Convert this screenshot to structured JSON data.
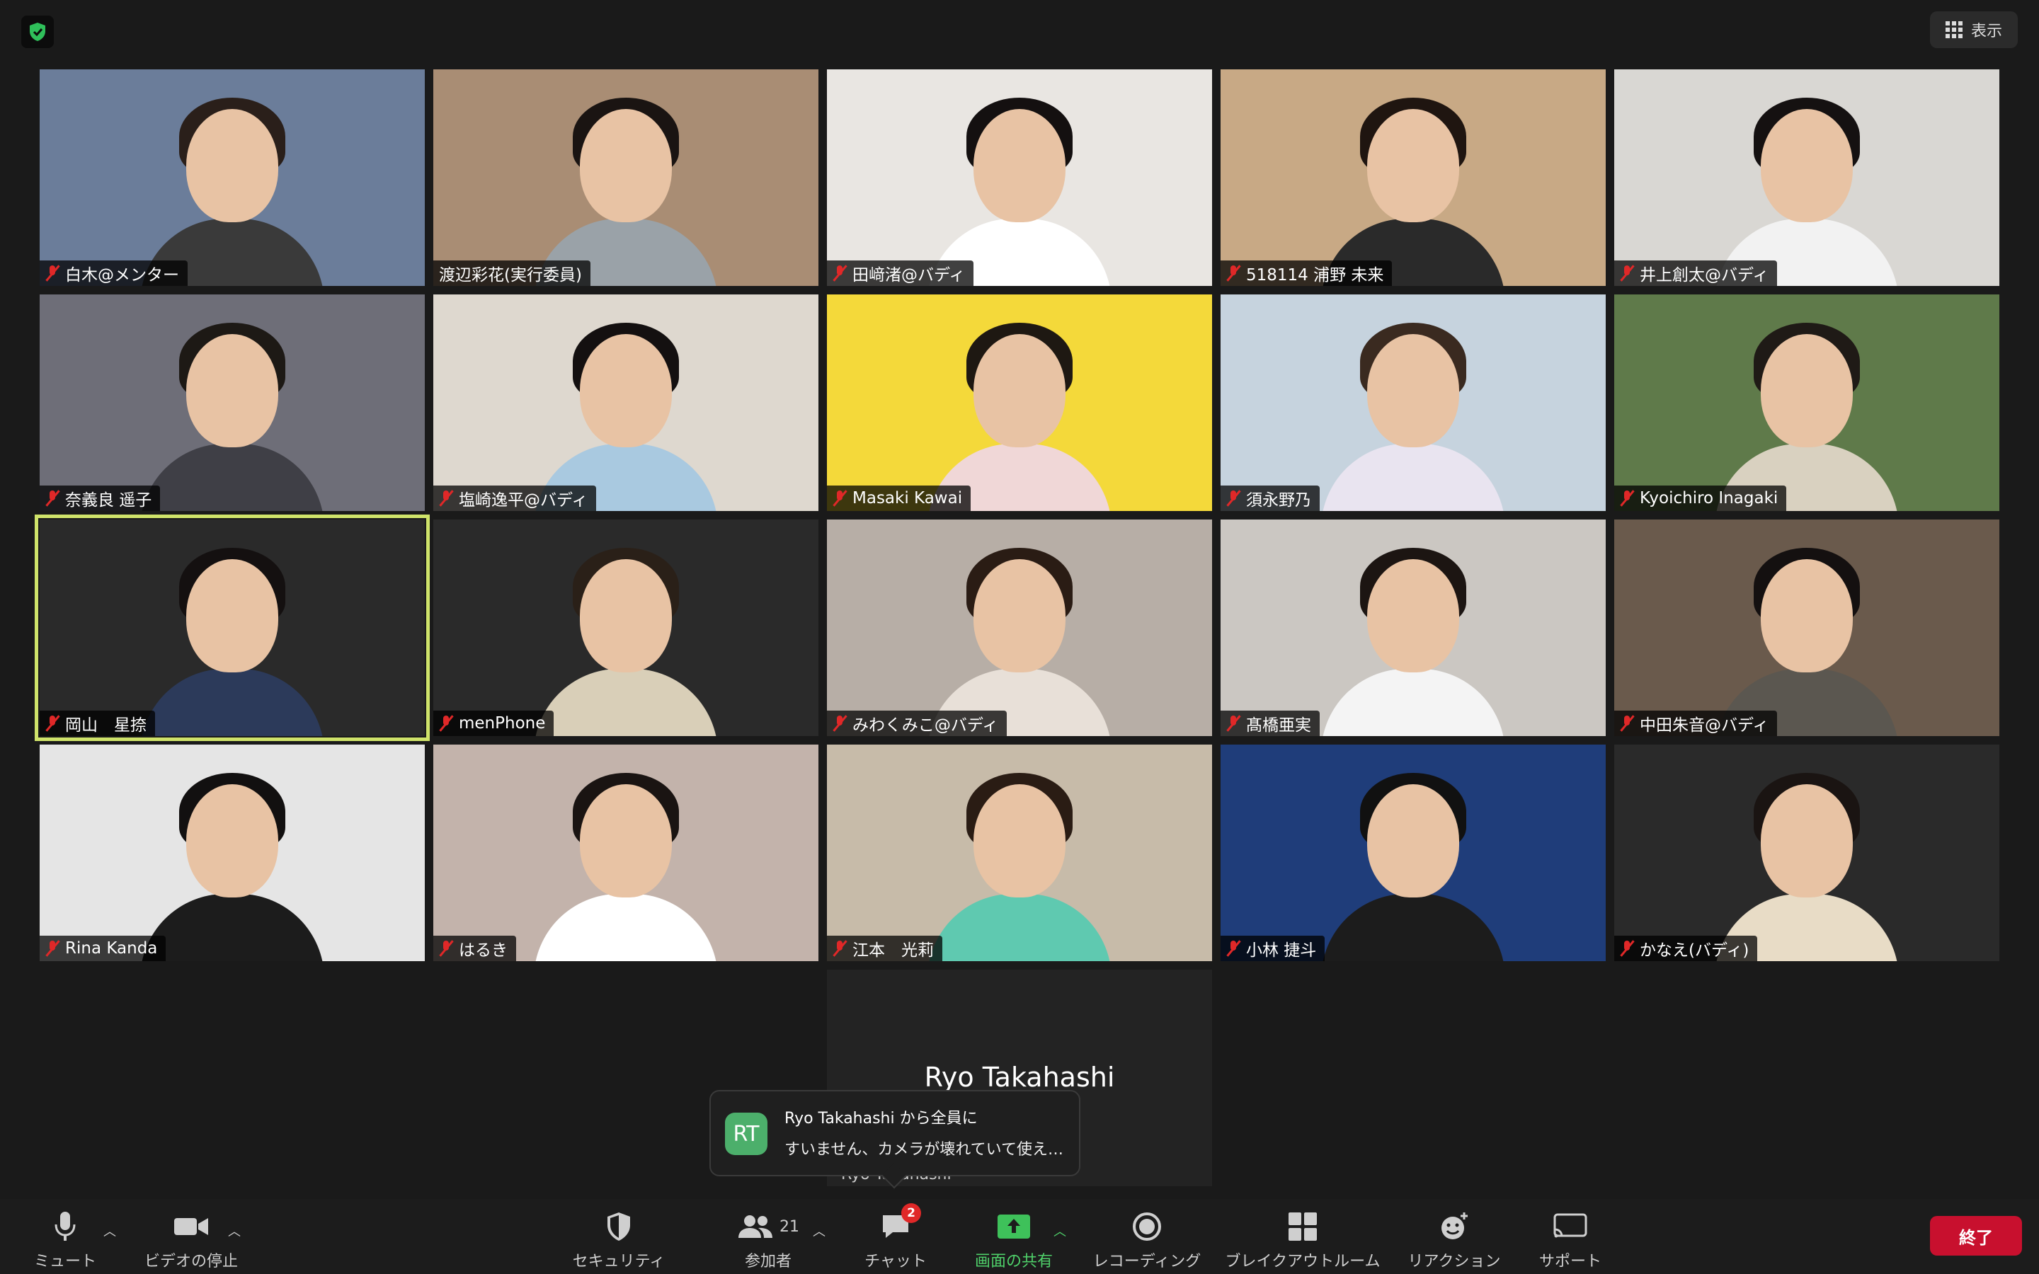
{
  "top": {
    "view_label": "表示"
  },
  "participants": [
    {
      "name": "白木@メンター",
      "muted": true,
      "bg": "#6b7d9a",
      "hair": "#2a1f1a",
      "shirt": "#3a3a3a"
    },
    {
      "name": "渡辺彩花(実行委員)",
      "muted": false,
      "bg": "#a98d74",
      "hair": "#1a1412",
      "shirt": "#9aa2a8"
    },
    {
      "name": "田﨑渚@バディ",
      "muted": true,
      "bg": "#e9e6e2",
      "hair": "#141010",
      "shirt": "#ffffff"
    },
    {
      "name": "518114 浦野 未来",
      "muted": true,
      "bg": "#c8a985",
      "hair": "#1f1510",
      "shirt": "#2a2a2a"
    },
    {
      "name": "井上創太@バディ",
      "muted": true,
      "bg": "#d9d7d3",
      "hair": "#151111",
      "shirt": "#f2f2f2"
    },
    {
      "name": "奈義良 遥子",
      "muted": true,
      "bg": "#6e6e78",
      "hair": "#1d1915",
      "shirt": "#3f3f46"
    },
    {
      "name": "塩崎逸平@バディ",
      "muted": true,
      "bg": "#ded8cf",
      "hair": "#141010",
      "shirt": "#a9c9e0"
    },
    {
      "name": "Masaki Kawai",
      "muted": true,
      "bg": "#f4d93a",
      "hair": "#1e1812",
      "shirt": "#f0d7d7"
    },
    {
      "name": "須永野乃",
      "muted": true,
      "bg": "#c6d3de",
      "hair": "#3a2a20",
      "shirt": "#e9e4f0"
    },
    {
      "name": "Kyoichiro Inagaki",
      "muted": true,
      "bg": "#5f7a4a",
      "hair": "#1f1a16",
      "shirt": "#d9d1c0"
    },
    {
      "name": "岡山　星捺",
      "muted": true,
      "bg": "#2a2a2a",
      "hair": "#141010",
      "shirt": "#2c3a5a"
    },
    {
      "name": "menPhone",
      "muted": true,
      "bg": "#2a2a2a",
      "hair": "#2a2018",
      "shirt": "#d9cfb8"
    },
    {
      "name": "みわくみこ@バディ",
      "muted": true,
      "bg": "#b7aea6",
      "hair": "#2a1c14",
      "shirt": "#e8e0d8"
    },
    {
      "name": "髙橋亜実",
      "muted": true,
      "bg": "#cbc7c2",
      "hair": "#1c1512",
      "shirt": "#f4f4f4"
    },
    {
      "name": "中田朱音@バディ",
      "muted": true,
      "bg": "#6a5a4c",
      "hair": "#141010",
      "shirt": "#5b5750"
    },
    {
      "name": "Rina Kanda",
      "muted": true,
      "bg": "#e5e5e5",
      "hair": "#121010",
      "shirt": "#1c1c1c"
    },
    {
      "name": "はるき",
      "muted": true,
      "bg": "#c3b3ab",
      "hair": "#1a1412",
      "shirt": "#ffffff"
    },
    {
      "name": "江本　光莉",
      "muted": true,
      "bg": "#c7bba9",
      "hair": "#2a1c14",
      "shirt": "#5fc9b0"
    },
    {
      "name": "小林 捷斗",
      "muted": true,
      "bg": "#1f3d7a",
      "hair": "#111111",
      "shirt": "#1c1c1c"
    },
    {
      "name": "かなえ(バディ)",
      "muted": true,
      "bg": "#2a2a2a",
      "hair": "#1a1412",
      "shirt": "#e8dcc6"
    }
  ],
  "camera_off_tile": {
    "name": "Ryo Takahashi",
    "small_name": "Ryo  Takahashi"
  },
  "chat_popup": {
    "avatar": "RT",
    "from": "Ryo Takahashi から全員に",
    "message": "すいません、カメラが壊れていて使え…"
  },
  "toolbar": {
    "mute": "ミュート",
    "video": "ビデオの停止",
    "security": "セキュリティ",
    "participants": "参加者",
    "participants_count": "21",
    "chat": "チャット",
    "chat_badge": "2",
    "share": "画面の共有",
    "record": "レコーディング",
    "breakout": "ブレイクアウトルーム",
    "reactions": "リアクション",
    "support": "サポート",
    "end": "終了"
  }
}
